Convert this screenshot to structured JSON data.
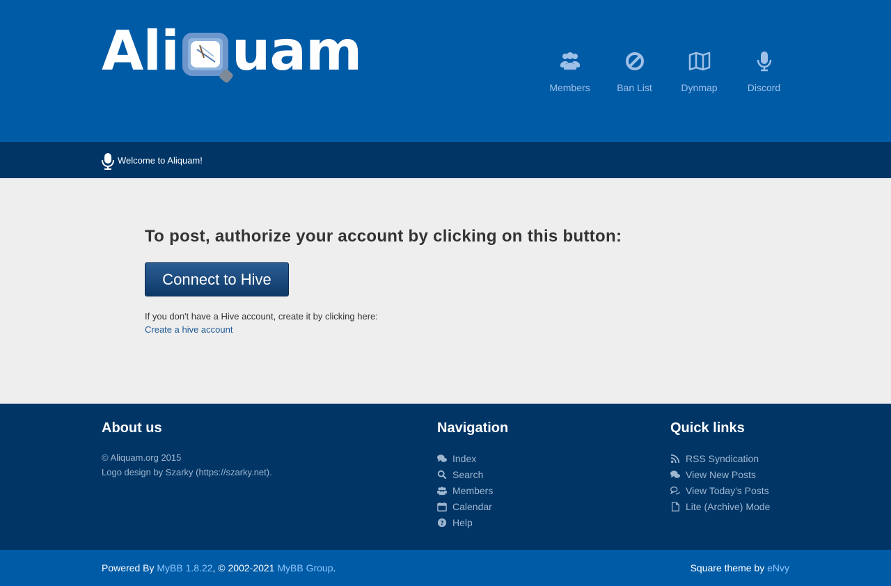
{
  "header": {
    "logo_left": "Ali",
    "logo_right": "uam",
    "nav": [
      {
        "label": "Members",
        "icon": "users-icon"
      },
      {
        "label": "Ban List",
        "icon": "ban-icon"
      },
      {
        "label": "Dynmap",
        "icon": "map-icon"
      },
      {
        "label": "Discord",
        "icon": "microphone-icon"
      }
    ]
  },
  "welcome": {
    "text": "Welcome to Aliquam!",
    "icon": "microphone-icon"
  },
  "main": {
    "heading": "To post, authorize your account by clicking on this button:",
    "button_label": "Connect to Hive",
    "note": "If you don't have a Hive account, create it by clicking here:",
    "create_link": "Create a hive account"
  },
  "footer": {
    "about": {
      "title": "About us",
      "line1": "© Aliquam.org 2015",
      "line2": "Logo design by Szarky (https://szarky.net)."
    },
    "navigation": {
      "title": "Navigation",
      "items": [
        {
          "label": "Index",
          "icon": "comments-icon"
        },
        {
          "label": "Search",
          "icon": "search-icon"
        },
        {
          "label": "Members",
          "icon": "users-icon"
        },
        {
          "label": "Calendar",
          "icon": "calendar-icon"
        },
        {
          "label": "Help",
          "icon": "question-icon"
        }
      ]
    },
    "quick": {
      "title": "Quick links",
      "items": [
        {
          "label": "RSS Syndication",
          "icon": "rss-icon"
        },
        {
          "label": "View New Posts",
          "icon": "comments-icon"
        },
        {
          "label": "View Today's Posts",
          "icon": "comments-outline-icon"
        },
        {
          "label": "Lite (Archive) Mode",
          "icon": "file-icon"
        }
      ]
    }
  },
  "bottom": {
    "powered_prefix": "Powered By ",
    "mybb_link": "MyBB 1.8.22",
    "copyright": ", © 2002-2021 ",
    "group_link": "MyBB Group",
    "period": ".",
    "theme_prefix": "Square theme by ",
    "theme_author": "eNvy"
  },
  "colors": {
    "header_bg": "#005ba6",
    "dark_bar": "#003566",
    "main_bg": "#eeeeee",
    "link": "#8cc6ff"
  }
}
